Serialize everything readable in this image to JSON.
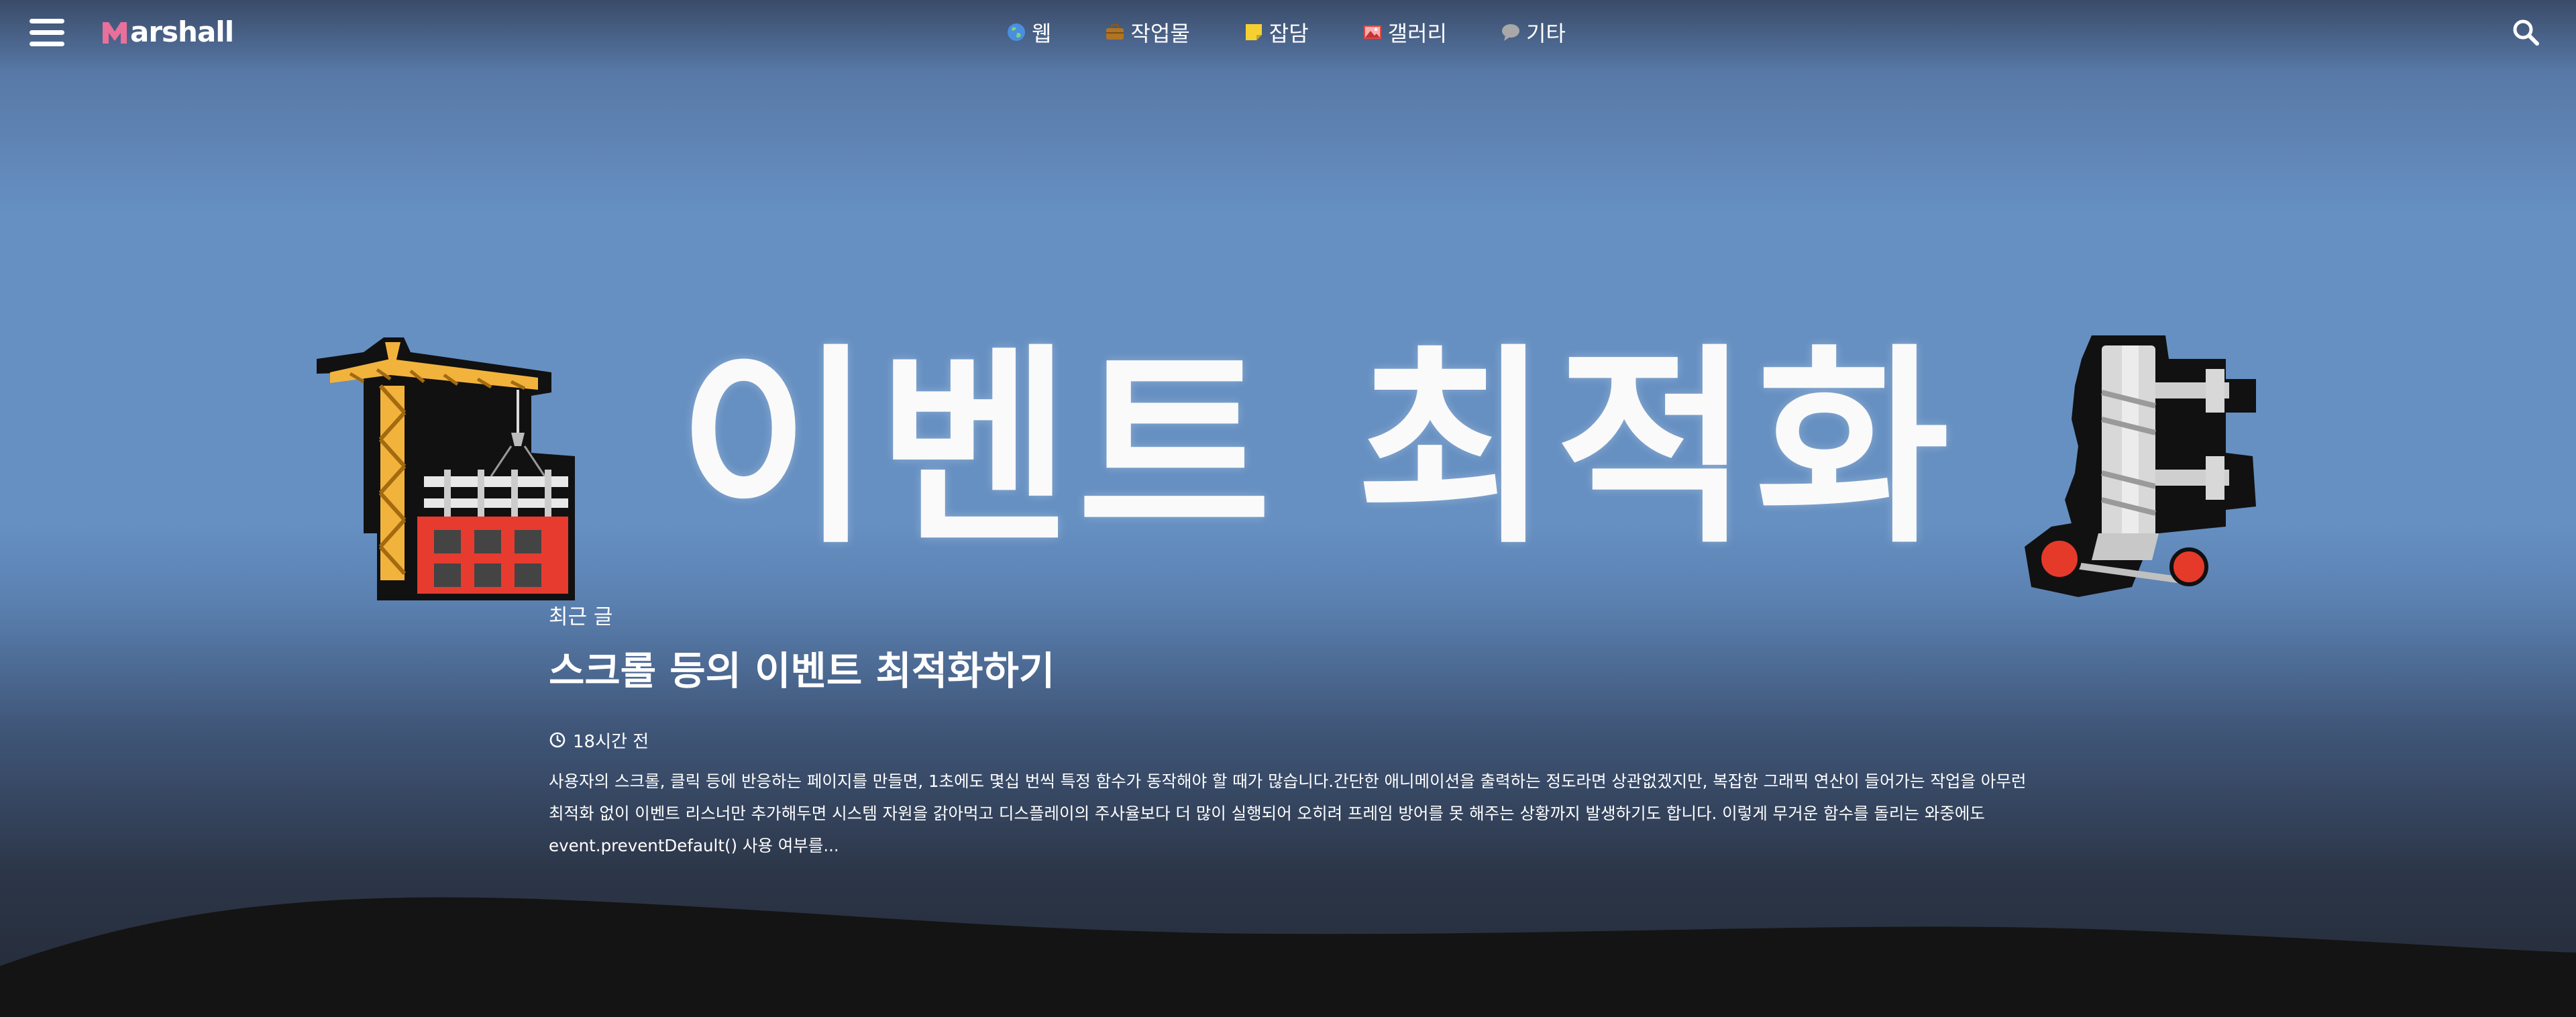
{
  "header": {
    "logo_text": "arshall",
    "menu_icon": "hamburger-menu-icon",
    "search_icon": "search-icon"
  },
  "nav": [
    {
      "label": "웹",
      "icon": "globe-icon"
    },
    {
      "label": "작업물",
      "icon": "briefcase-icon"
    },
    {
      "label": "잡담",
      "icon": "sticky-note-icon"
    },
    {
      "label": "갤러리",
      "icon": "image-icon"
    },
    {
      "label": "기타",
      "icon": "speech-bubble-icon"
    }
  ],
  "banner": {
    "title": "이벤트 최적화",
    "left_icon": "construction-crane-icon",
    "right_icon": "bone-icon"
  },
  "post": {
    "kicker": "최근 글",
    "title": "스크롤 등의 이벤트 최적화하기",
    "time": "18시간 전",
    "excerpt": "사용자의 스크롤, 클릭 등에 반응하는 페이지를 만들면, 1초에도 몇십 번씩 특정 함수가 동작해야 할 때가 많습니다.간단한 애니메이션을 출력하는 정도라면 상관없겠지만, 복잡한 그래픽 연산이 들어가는 작업을 아무런 최적화 없이 이벤트 리스너만 추가해두면 시스템 자원을 갉아먹고 디스플레이의 주사율보다 더 많이 실행되어 오히려 프레임 방어를 못 해주는 상황까지 발생하기도 합니다. 이렇게 무거운 함수를 돌리는 와중에도 event.preventDefault() 사용 여부를..."
  },
  "colors": {
    "hero_blue": "#6690c2",
    "footer_dark": "#141414",
    "logo_pink": "#e8709b"
  }
}
